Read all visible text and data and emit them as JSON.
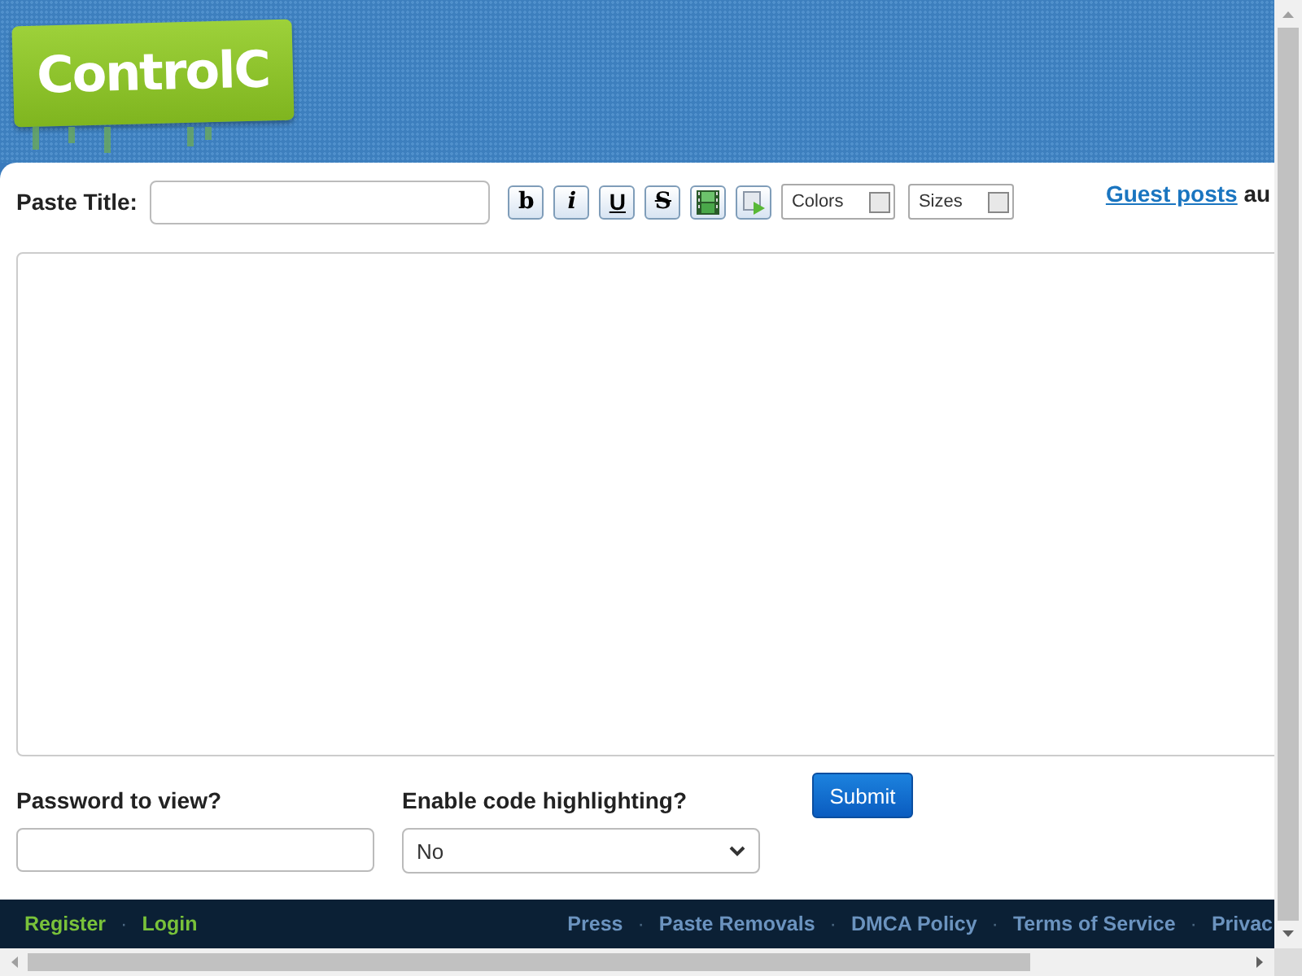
{
  "logo": {
    "text": "ControlC"
  },
  "form": {
    "title_label": "Paste Title:",
    "toolbar": [
      {
        "kind": "bold",
        "glyph": "b"
      },
      {
        "kind": "italic",
        "glyph": "i"
      },
      {
        "kind": "underline",
        "glyph": "U"
      },
      {
        "kind": "strike",
        "glyph": "S"
      },
      {
        "kind": "film"
      },
      {
        "kind": "image"
      }
    ],
    "dropdowns": [
      "Colors",
      "Sizes"
    ],
    "guest_link": "Guest posts",
    "guest_rest": "au",
    "password_label": "Password to view?",
    "highlight_label": "Enable code highlighting?",
    "highlight_value": "No",
    "submit": "Submit"
  },
  "footer": {
    "separator": "·",
    "left": [
      "Register",
      "Login"
    ],
    "right": [
      "Press",
      "Paste Removals",
      "DMCA Policy",
      "Terms of Service",
      "Privac"
    ]
  }
}
